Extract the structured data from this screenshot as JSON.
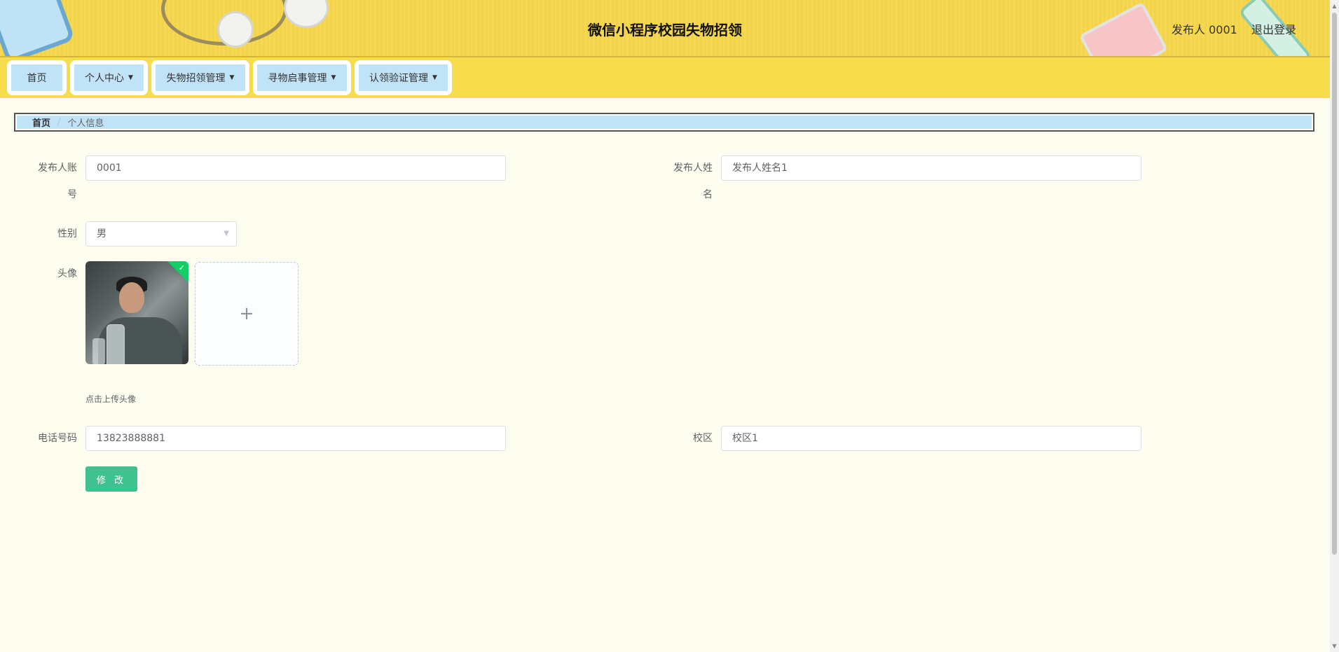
{
  "header": {
    "title": "微信小程序校园失物招领",
    "user": "发布人 0001",
    "logout": "退出登录"
  },
  "nav": [
    {
      "label": "首页",
      "has_arrow": false
    },
    {
      "label": "个人中心",
      "has_arrow": true
    },
    {
      "label": "失物招领管理",
      "has_arrow": true
    },
    {
      "label": "寻物启事管理",
      "has_arrow": true
    },
    {
      "label": "认领验证管理",
      "has_arrow": true
    }
  ],
  "breadcrumb": {
    "home": "首页",
    "separator": "/",
    "current": "个人信息"
  },
  "form": {
    "account_label_1": "发布人账",
    "account_label_2": "号",
    "account_value": "0001",
    "name_label_1": "发布人姓",
    "name_label_2": "名",
    "name_value": "发布人姓名1",
    "gender_label": "性别",
    "gender_value": "男",
    "avatar_label": "头像",
    "avatar_tip": "点击上传头像",
    "phone_label": "电话号码",
    "phone_value": "13823888881",
    "campus_label": "校区",
    "campus_value": "校区1",
    "submit": "修 改"
  },
  "colors": {
    "header_bg": "#f7d64a",
    "nav_item_bg": "#c1e3f7",
    "page_bg": "#fdfdf0",
    "primary_button": "#3ec28f"
  }
}
